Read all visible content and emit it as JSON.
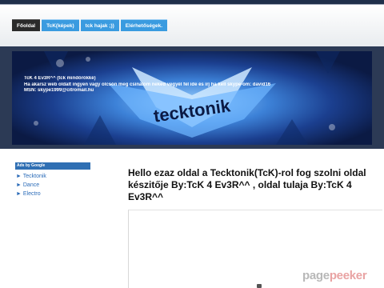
{
  "nav": {
    "items": [
      {
        "label": "Főoldal",
        "active": true
      },
      {
        "label": "TcK(képek)",
        "active": false
      },
      {
        "label": "tck hajak ;))",
        "active": false
      },
      {
        "label": "Elérhetőségek.",
        "active": false
      }
    ]
  },
  "banner": {
    "lines": [
      "TcK 4 Ev3R^^ (tck mindörökké)",
      "Ha akarsz web oldalt ingyen vagy olcsón meg csinálom neked vegyél fel ide és írj ha kell skype-om: david16",
      "MSN: skype1999@citromail.hu"
    ],
    "logo_text": "tecktonik"
  },
  "sidebar": {
    "ads_heading": "Ads by Google",
    "links": [
      "► Tecktonik",
      "► Dance",
      "► Electro"
    ]
  },
  "main": {
    "title": "Hello ezaz oldal a Tecktonik(TcK)-rol fog szolni oldal készitője By:TcK 4 Ev3R^^ , oldal tulaja By:TcK 4 Ev3R^^"
  },
  "watermark": {
    "part1": "page",
    "part2": "peeker"
  },
  "colors": {
    "nav_active": "#2b2b2b",
    "nav_item": "#3a9be0",
    "link": "#2a6bb8"
  }
}
